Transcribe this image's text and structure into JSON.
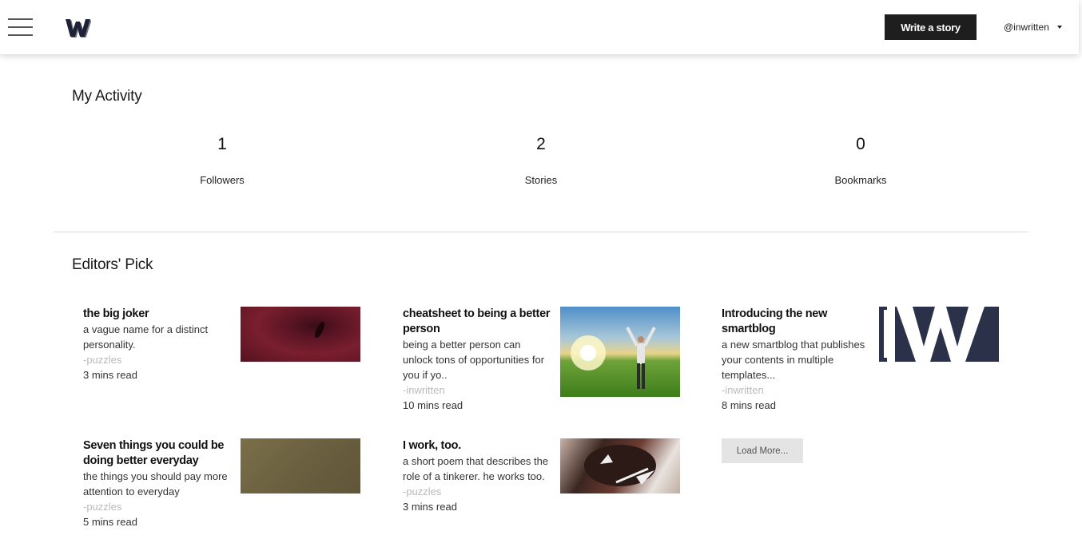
{
  "header": {
    "menu_icon": "hamburger-icon",
    "logo_icon": "w-logo-icon",
    "write_label": "Write a story",
    "username": "@inwritten",
    "caret_icon": "caret-down-icon"
  },
  "activity": {
    "title": "My Activity",
    "stats": [
      {
        "value": "1",
        "label": "Followers"
      },
      {
        "value": "2",
        "label": "Stories"
      },
      {
        "value": "0",
        "label": "Bookmarks"
      }
    ]
  },
  "picks": {
    "title": "Editors' Pick",
    "cards": [
      {
        "title": "the big joker",
        "desc": "a vague name for a distinct personality.",
        "author": "-puzzles",
        "read": "3 mins read"
      },
      {
        "title": "cheatsheet to being a better person",
        "desc": "being a better person can unlock tons of opportunities for you if yo..",
        "author": "-inwritten",
        "read": "10 mins read"
      },
      {
        "title": "Introducing the new smartblog",
        "desc": "a new smartblog that publishes your contents in multiple templates...",
        "author": "-inwritten",
        "read": "8 mins read"
      },
      {
        "title": "Seven things you could be doing better everyday",
        "desc": "the things you should pay more attention to everyday",
        "author": "-puzzles",
        "read": "5 mins read"
      },
      {
        "title": "I work, too.",
        "desc": "a short poem that describes the role of a tinkerer. he works too.",
        "author": "-puzzles",
        "read": "3 mins read"
      }
    ],
    "load_more": "Load More..."
  }
}
